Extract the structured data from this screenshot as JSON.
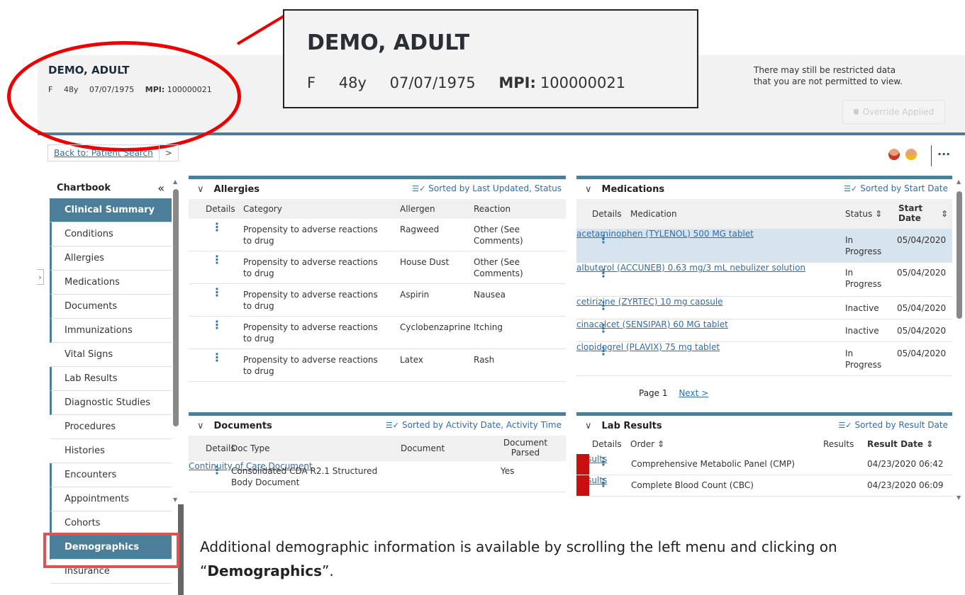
{
  "patient": {
    "name": "DEMO, ADULT",
    "sex": "F",
    "age": "48y",
    "dob": "07/07/1975",
    "mpi_label": "MPI:",
    "mpi_value": "100000021"
  },
  "header": {
    "restricted_text": "There may still be restricted data that you are not permitted to view.",
    "override_label": "Override Applied"
  },
  "nav": {
    "back_label": "Back to: Patient Search",
    "back_chevron": ">"
  },
  "sidebar": {
    "title": "Chartbook",
    "collapse_icon": "«",
    "items": [
      {
        "label": "Clinical Summary"
      },
      {
        "label": "Conditions"
      },
      {
        "label": "Allergies"
      },
      {
        "label": "Medications"
      },
      {
        "label": "Documents"
      },
      {
        "label": "Immunizations"
      },
      {
        "label": "Vital Signs"
      },
      {
        "label": "Lab Results"
      },
      {
        "label": "Diagnostic Studies"
      },
      {
        "label": "Procedures"
      },
      {
        "label": "Histories"
      },
      {
        "label": "Encounters"
      },
      {
        "label": "Appointments"
      },
      {
        "label": "Cohorts"
      },
      {
        "label": "Demographics"
      },
      {
        "label": "Insurance"
      }
    ]
  },
  "allergies": {
    "title": "Allergies",
    "sort": "Sorted by Last Updated, Status",
    "cols": [
      "Details",
      "Category",
      "Allergen",
      "Reaction"
    ],
    "rows": [
      {
        "category": "Propensity to adverse reactions to drug",
        "allergen": "Ragweed",
        "reaction": "Other (See Comments)"
      },
      {
        "category": "Propensity to adverse reactions to drug",
        "allergen": "House Dust",
        "reaction": "Other (See Comments)"
      },
      {
        "category": "Propensity to adverse reactions to drug",
        "allergen": "Aspirin",
        "reaction": "Nausea"
      },
      {
        "category": "Propensity to adverse reactions to drug",
        "allergen": "Cyclobenzaprine",
        "reaction": "Itching"
      },
      {
        "category": "Propensity to adverse reactions to drug",
        "allergen": "Latex",
        "reaction": "Rash"
      }
    ]
  },
  "medications": {
    "title": "Medications",
    "sort": "Sorted by Start Date",
    "cols": [
      "Details",
      "Medication",
      "Status",
      "Start Date"
    ],
    "rows": [
      {
        "name": "acetaminophen (TYLENOL) 500 MG tablet",
        "status": "In Progress",
        "date": "05/04/2020"
      },
      {
        "name": "albuterol (ACCUNEB) 0.63 mg/3 mL nebulizer solution",
        "status": "In Progress",
        "date": "05/04/2020"
      },
      {
        "name": "cetirizine (ZYRTEC) 10 mg capsule",
        "status": "Inactive",
        "date": "05/04/2020"
      },
      {
        "name": "cinacalcet (SENSIPAR) 60 MG tablet",
        "status": "Inactive",
        "date": "05/04/2020"
      },
      {
        "name": "clopidogrel (PLAVIX) 75 mg tablet",
        "status": "In Progress",
        "date": "05/04/2020"
      }
    ],
    "page_label": "Page 1",
    "next_label": "Next >"
  },
  "documents": {
    "title": "Documents",
    "sort": "Sorted by Activity Date, Activity Time",
    "cols": [
      "Details",
      "Doc Type",
      "Document",
      "Document Parsed"
    ],
    "rows": [
      {
        "type": "Consolidated CDA R2.1 Structured Body Document",
        "doc": "Continuity of Care Document",
        "parsed": "Yes"
      }
    ]
  },
  "labs": {
    "title": "Lab Results",
    "sort": "Sorted by Result Date",
    "cols": [
      "Details",
      "Order",
      "Results",
      "Result Date"
    ],
    "rows": [
      {
        "order": "Comprehensive Metabolic Panel (CMP)",
        "results": "Results",
        "date": "04/23/2020 06:42"
      },
      {
        "order": "Complete Blood Count (CBC)",
        "results": "Results",
        "date": "04/23/2020 06:09"
      }
    ]
  },
  "caption": {
    "prefix": "Additional demographic information is available by scrolling the left menu and clicking on “",
    "bold": "Demographics",
    "suffix": "”."
  },
  "colors": {
    "accent": "#4a7e99",
    "link": "#2a6fb0",
    "flag": "#c81010",
    "callout": "#e00000"
  }
}
